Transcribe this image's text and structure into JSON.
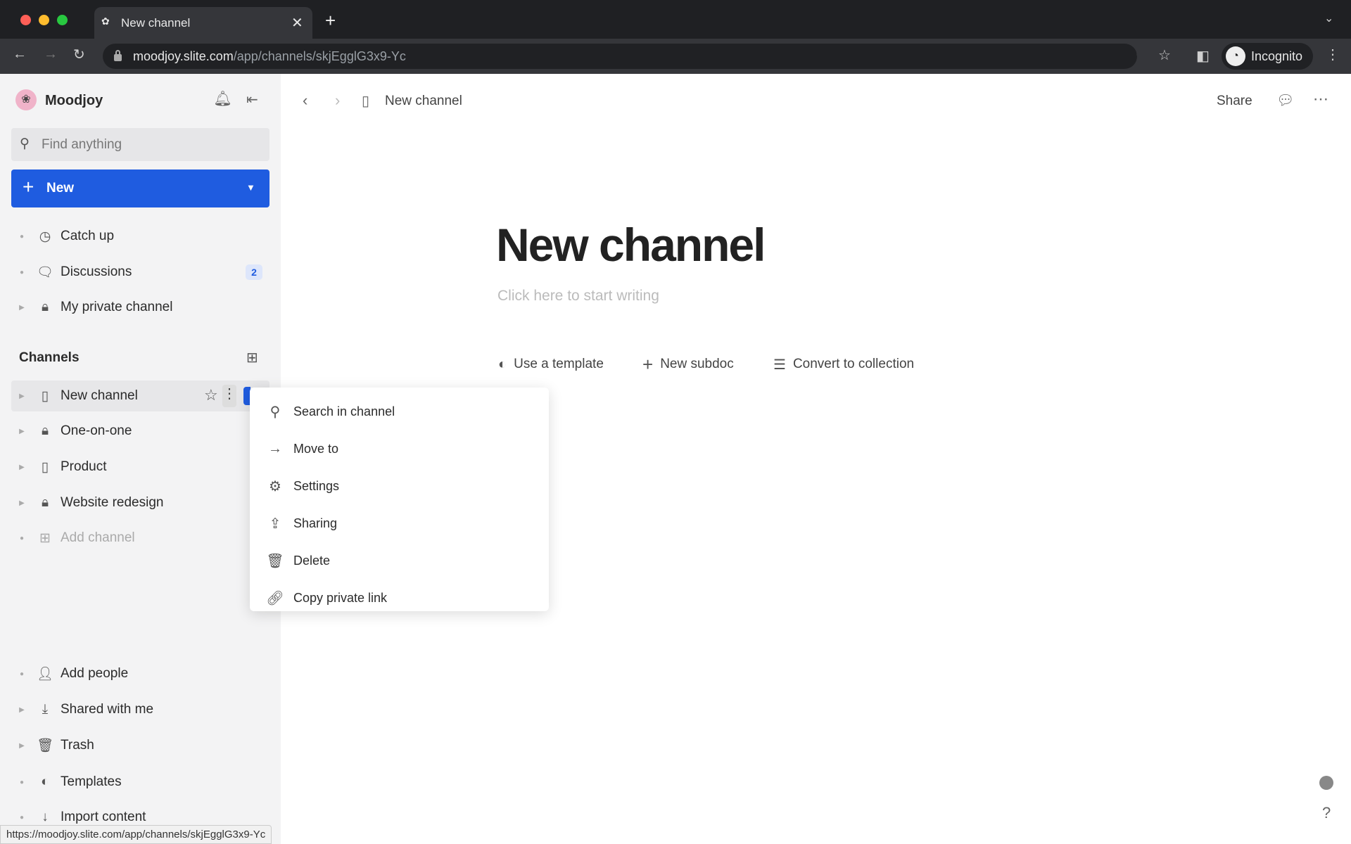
{
  "browser": {
    "tab_title": "New channel",
    "url_host": "moodjoy.slite.com",
    "url_path": "/app/channels/skjEgglG3x9-Yc",
    "profile": "Incognito",
    "status_url": "https://moodjoy.slite.com/app/channels/skjEgglG3x9-Yc"
  },
  "sidebar": {
    "workspace": "Moodjoy",
    "search_placeholder": "Find anything",
    "new_label": "New",
    "top_items": [
      {
        "label": "Catch up",
        "icon": "clock-icon"
      },
      {
        "label": "Discussions",
        "icon": "chat-icon",
        "badge": "2"
      },
      {
        "label": "My private channel",
        "icon": "lock-icon"
      }
    ],
    "channels_heading": "Channels",
    "channels": [
      {
        "label": "New channel",
        "icon": "doc-icon"
      },
      {
        "label": "One-on-one",
        "icon": "lock-icon"
      },
      {
        "label": "Product",
        "icon": "doc-icon"
      },
      {
        "label": "Website redesign",
        "icon": "lock-icon"
      },
      {
        "label": "Add channel",
        "icon": "add-doc-icon"
      }
    ],
    "bottom_items": [
      {
        "label": "Add people",
        "icon": "person-add-icon"
      },
      {
        "label": "Shared with me",
        "icon": "download-icon"
      },
      {
        "label": "Trash",
        "icon": "trash-icon"
      },
      {
        "label": "Templates",
        "icon": "template-icon"
      },
      {
        "label": "Import content",
        "icon": "import-icon"
      }
    ]
  },
  "context_menu": [
    {
      "label": "Search in channel",
      "icon": "search-icon"
    },
    {
      "label": "Move to",
      "icon": "arrow-right-icon"
    },
    {
      "label": "Settings",
      "icon": "gear-icon"
    },
    {
      "label": "Sharing",
      "icon": "share-icon"
    },
    {
      "label": "Delete",
      "icon": "trash-icon"
    },
    {
      "label": "Copy private link",
      "icon": "link-icon"
    }
  ],
  "header": {
    "breadcrumb": "New channel",
    "share_label": "Share"
  },
  "doc": {
    "title": "New channel",
    "placeholder": "Click here to start writing",
    "actions": [
      "Use a template",
      "New subdoc",
      "Convert to collection"
    ]
  },
  "help_label": "?"
}
